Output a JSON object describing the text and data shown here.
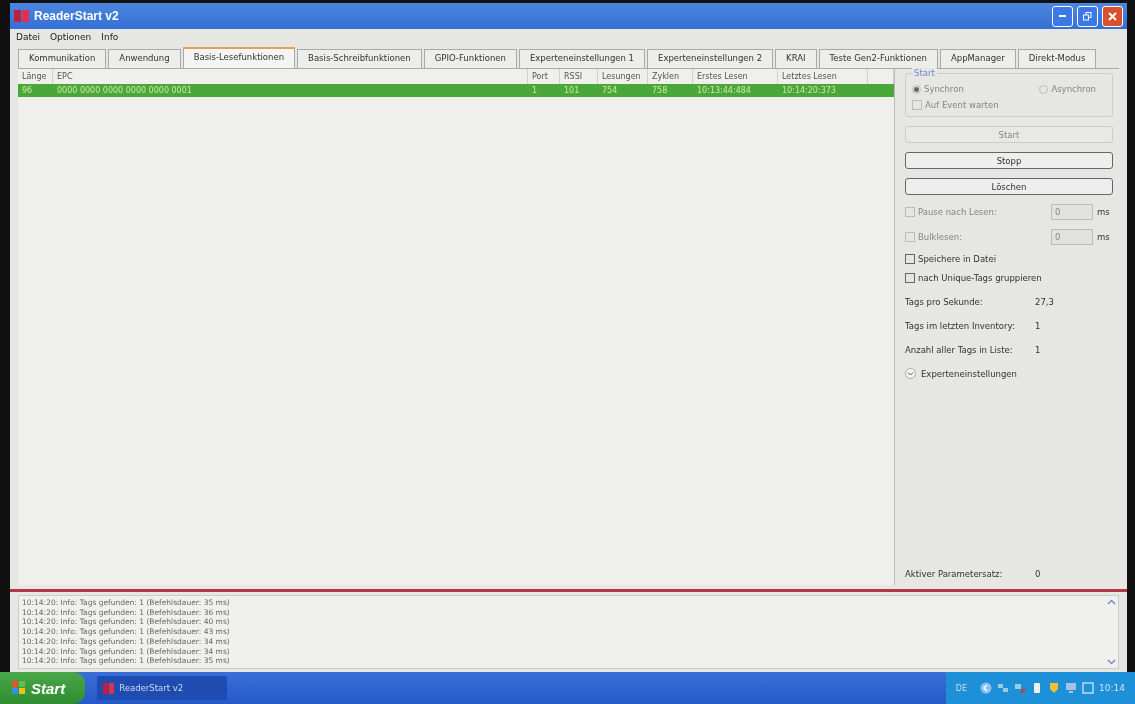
{
  "window": {
    "title": "ReaderStart v2"
  },
  "menu": [
    "Datei",
    "Optionen",
    "Info"
  ],
  "tabs": [
    {
      "label": "Kommunikation",
      "selected": false
    },
    {
      "label": "Anwendung",
      "selected": false
    },
    {
      "label": "Basis-Lesefunktionen",
      "selected": true
    },
    {
      "label": "Basis-Schreibfunktionen",
      "selected": false
    },
    {
      "label": "GPIO-Funktionen",
      "selected": false
    },
    {
      "label": "Experteneinstellungen 1",
      "selected": false
    },
    {
      "label": "Experteneinstellungen 2",
      "selected": false
    },
    {
      "label": "KRAI",
      "selected": false
    },
    {
      "label": "Teste Gen2-Funktionen",
      "selected": false
    },
    {
      "label": "AppManager",
      "selected": false
    },
    {
      "label": "Direkt-Modus",
      "selected": false
    }
  ],
  "table": {
    "columns": [
      "Länge",
      "EPC",
      "Port",
      "RSSI",
      "Lesungen",
      "Zyklen",
      "Erstes Lesen",
      "Letztes Lesen"
    ],
    "rows": [
      {
        "cells": [
          "96",
          "0000 0000 0000 0000 0000 0001",
          "1",
          "101",
          "754",
          "758",
          "10:13:44:484",
          "10:14:20:373"
        ],
        "selected": true
      }
    ]
  },
  "start_group": {
    "title": "Start",
    "radios": [
      {
        "label": "Synchron",
        "selected": true
      },
      {
        "label": "Asynchron",
        "selected": false
      }
    ],
    "disabled": true,
    "checkbox": {
      "label": "Auf Event warten",
      "checked": false
    }
  },
  "buttons": [
    {
      "label": "Start",
      "disabled": true
    },
    {
      "label": "Stopp",
      "disabled": false
    },
    {
      "label": "Löschen",
      "disabled": false
    }
  ],
  "options": [
    {
      "kind": "timed",
      "label": "Pause nach Lesen:",
      "checked": false,
      "disabled": true,
      "value": "0",
      "unit": "ms"
    },
    {
      "kind": "timed",
      "label": "Bulklesen:",
      "checked": false,
      "disabled": true,
      "value": "0",
      "unit": "ms"
    },
    {
      "kind": "check",
      "label": "Speichere in Datei",
      "checked": false,
      "disabled": false
    },
    {
      "kind": "check",
      "label": "nach Unique-Tags gruppieren",
      "checked": false,
      "disabled": false
    }
  ],
  "stats": [
    {
      "label": "Tags pro Sekunde:",
      "value": "27,3"
    },
    {
      "label": "Tags im letzten Inventory:",
      "value": "1"
    },
    {
      "label": "Anzahl aller Tags in Liste:",
      "value": "1"
    }
  ],
  "expander": {
    "label": "Experteneinstellungen",
    "expanded": false
  },
  "active_parameter": {
    "label": "Aktiver Parametersatz:",
    "value": "0"
  },
  "log": [
    "10:14:20: Info: Tags gefunden: 1 (Befehlsdauer: 35 ms)",
    "10:14:20: Info: Tags gefunden: 1 (Befehlsdauer: 36 ms)",
    "10:14:20: Info: Tags gefunden: 1 (Befehlsdauer: 40 ms)",
    "10:14:20: Info: Tags gefunden: 1 (Befehlsdauer: 43 ms)",
    "10:14:20: Info: Tags gefunden: 1 (Befehlsdauer: 34 ms)",
    "10:14:20: Info: Tags gefunden: 1 (Befehlsdauer: 34 ms)",
    "10:14:20: Info: Tags gefunden: 1 (Befehlsdauer: 35 ms)"
  ],
  "taskbar": {
    "start": "Start",
    "tasks": [
      {
        "label": "ReaderStart v2",
        "selected": true
      }
    ],
    "language": "DE",
    "clock": "10:14"
  }
}
